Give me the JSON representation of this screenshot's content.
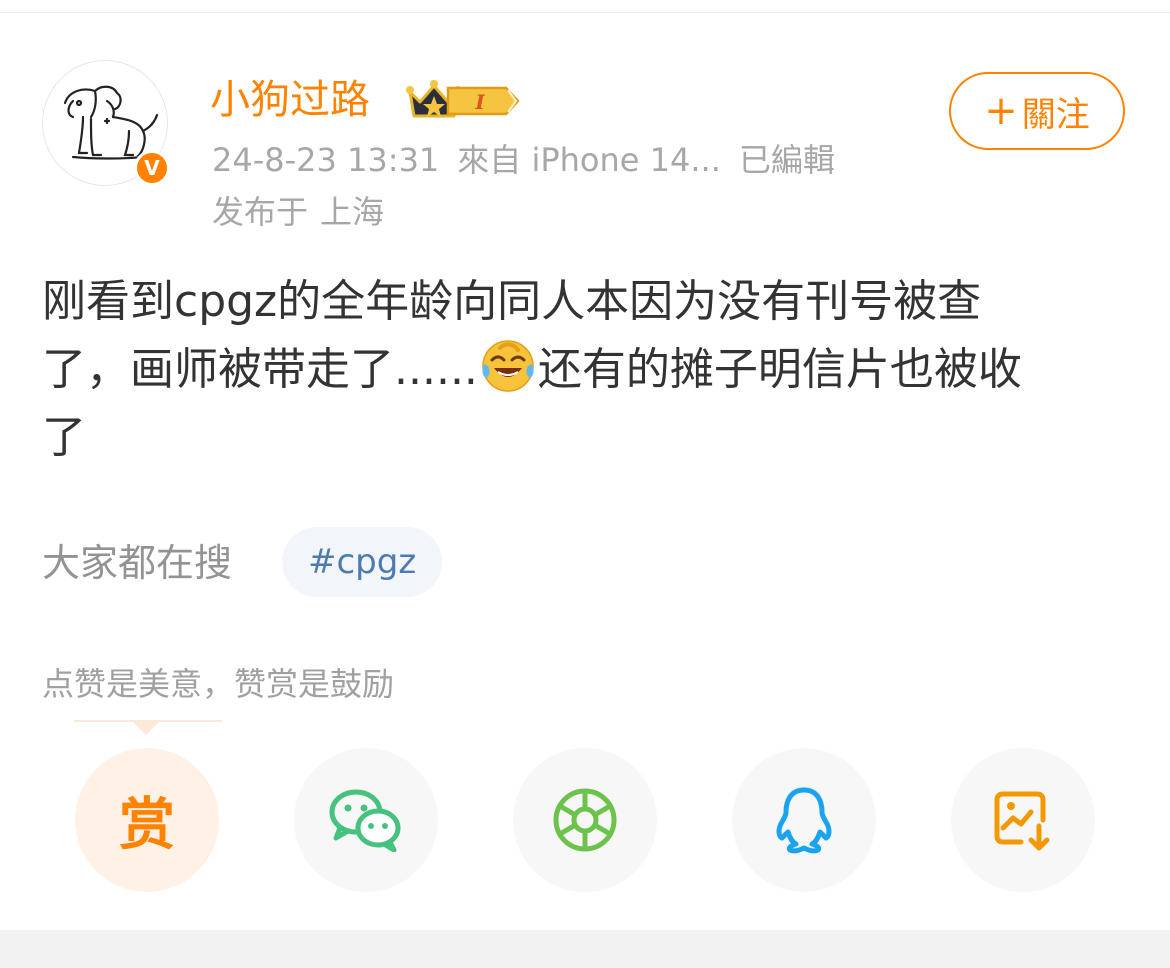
{
  "header": {
    "username": "小狗过路",
    "level_badge": "I",
    "follow_label": "關注",
    "follow_plus": "+",
    "verified_mark": "V",
    "meta": {
      "timestamp": "24-8-23 13:31",
      "source": "來自 iPhone 14...",
      "edited": "已編輯"
    },
    "location": {
      "prefix": "发布于",
      "place": "上海"
    }
  },
  "post": {
    "line1": "刚看到cpgz的全年龄向同人本因为没有刊号被查",
    "line2_before": "了，画师被带走了......",
    "line2_after": "还有的摊子明信片也被收",
    "line3": "了",
    "emoji_name": "laugh-cry-emoji"
  },
  "search": {
    "label": "大家都在搜",
    "hashtag": "#cpgz"
  },
  "reward": {
    "text": "点赞是美意，赞赏是鼓励",
    "button_glyph": "赏"
  },
  "share": {
    "items": [
      {
        "icon": "reward-icon"
      },
      {
        "icon": "wechat-icon"
      },
      {
        "icon": "moments-icon"
      },
      {
        "icon": "qq-icon"
      },
      {
        "icon": "save-image-icon"
      }
    ]
  },
  "colors": {
    "brand_orange": "#ff8200",
    "text_main": "#333333",
    "text_meta": "#a7a7a7",
    "hashtag_blue": "#4f7cb0",
    "wechat_green": "#45c27e",
    "moments_green": "#6cc24a",
    "qq_blue": "#1aa4ef",
    "save_orange": "#f39800"
  }
}
